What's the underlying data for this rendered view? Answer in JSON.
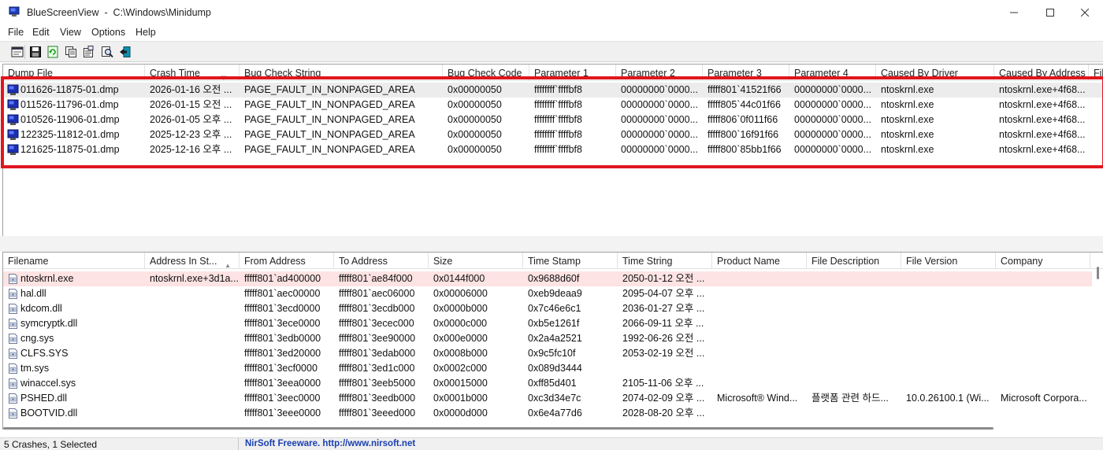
{
  "window": {
    "title": "BlueScreenView  -  C:\\Windows\\Minidump",
    "icon": "bluescreen-monitor-icon"
  },
  "menu": [
    "File",
    "Edit",
    "View",
    "Options",
    "Help"
  ],
  "toolbar": {
    "icons": [
      "html-report-icon",
      "save-icon",
      "refresh-icon",
      "copy-icon",
      "properties-icon",
      "find-icon",
      "exit-icon"
    ]
  },
  "crash_list": {
    "columns": [
      "Dump File",
      "Crash Time",
      "Bug Check String",
      "Bug Check Code",
      "Parameter 1",
      "Parameter 2",
      "Parameter 3",
      "Parameter 4",
      "Caused By Driver",
      "Caused By Address",
      "Fil"
    ],
    "rows": [
      [
        "011626-11875-01.dmp",
        "2026-01-16 오전 ...",
        "PAGE_FAULT_IN_NONPAGED_AREA",
        "0x00000050",
        "ffffffff`ffffbf8",
        "00000000`0000...",
        "fffff801`41521f66",
        "00000000`0000...",
        "ntoskrnl.exe",
        "ntoskrnl.exe+4f68..."
      ],
      [
        "011526-11796-01.dmp",
        "2026-01-15 오전 ...",
        "PAGE_FAULT_IN_NONPAGED_AREA",
        "0x00000050",
        "ffffffff`ffffbf8",
        "00000000`0000...",
        "fffff805`44c01f66",
        "00000000`0000...",
        "ntoskrnl.exe",
        "ntoskrnl.exe+4f68..."
      ],
      [
        "010526-11906-01.dmp",
        "2026-01-05 오후 ...",
        "PAGE_FAULT_IN_NONPAGED_AREA",
        "0x00000050",
        "ffffffff`ffffbf8",
        "00000000`0000...",
        "fffff806`0f011f66",
        "00000000`0000...",
        "ntoskrnl.exe",
        "ntoskrnl.exe+4f68..."
      ],
      [
        "122325-11812-01.dmp",
        "2025-12-23 오후 ...",
        "PAGE_FAULT_IN_NONPAGED_AREA",
        "0x00000050",
        "ffffffff`ffffbf8",
        "00000000`0000...",
        "fffff800`16f91f66",
        "00000000`0000...",
        "ntoskrnl.exe",
        "ntoskrnl.exe+4f68..."
      ],
      [
        "121625-11875-01.dmp",
        "2025-12-16 오후 ...",
        "PAGE_FAULT_IN_NONPAGED_AREA",
        "0x00000050",
        "ffffffff`ffffbf8",
        "00000000`0000...",
        "fffff800`85bb1f66",
        "00000000`0000...",
        "ntoskrnl.exe",
        "ntoskrnl.exe+4f68..."
      ]
    ]
  },
  "driver_list": {
    "columns": [
      "Filename",
      "Address In St...",
      "From Address",
      "To Address",
      "Size",
      "Time Stamp",
      "Time String",
      "Product Name",
      "File Description",
      "File Version",
      "Company"
    ],
    "rows": [
      [
        "ntoskrnl.exe",
        "ntoskrnl.exe+3d1a...",
        "fffff801`ad400000",
        "fffff801`ae84f000",
        "0x0144f000",
        "0x9688d60f",
        "2050-01-12 오전 ...",
        "",
        "",
        "",
        ""
      ],
      [
        "hal.dll",
        "",
        "fffff801`aec00000",
        "fffff801`aec06000",
        "0x00006000",
        "0xeb9deaa9",
        "2095-04-07 오후 ...",
        "",
        "",
        "",
        ""
      ],
      [
        "kdcom.dll",
        "",
        "fffff801`3ecd0000",
        "fffff801`3ecdb000",
        "0x0000b000",
        "0x7c46e6c1",
        "2036-01-27 오후 ...",
        "",
        "",
        "",
        ""
      ],
      [
        "symcryptk.dll",
        "",
        "fffff801`3ece0000",
        "fffff801`3ecec000",
        "0x0000c000",
        "0xb5e1261f",
        "2066-09-11 오후 ...",
        "",
        "",
        "",
        ""
      ],
      [
        "cng.sys",
        "",
        "fffff801`3edb0000",
        "fffff801`3ee90000",
        "0x000e0000",
        "0x2a4a2521",
        "1992-06-26 오전 ...",
        "",
        "",
        "",
        ""
      ],
      [
        "CLFS.SYS",
        "",
        "fffff801`3ed20000",
        "fffff801`3edab000",
        "0x0008b000",
        "0x9c5fc10f",
        "2053-02-19 오전 ...",
        "",
        "",
        "",
        ""
      ],
      [
        "tm.sys",
        "",
        "fffff801`3ecf0000",
        "fffff801`3ed1c000",
        "0x0002c000",
        "0x089d3444",
        "",
        "",
        "",
        "",
        ""
      ],
      [
        "winaccel.sys",
        "",
        "fffff801`3eea0000",
        "fffff801`3eeb5000",
        "0x00015000",
        "0xff85d401",
        "2105-11-06 오후 ...",
        "",
        "",
        "",
        ""
      ],
      [
        "PSHED.dll",
        "",
        "fffff801`3eec0000",
        "fffff801`3eedb000",
        "0x0001b000",
        "0xc3d34e7c",
        "2074-02-09 오후 ...",
        "Microsoft® Wind...",
        "플랫폼 관련 하드...",
        "10.0.26100.1 (Wi...",
        "Microsoft Corpora..."
      ],
      [
        "BOOTVID.dll",
        "",
        "fffff801`3eee0000",
        "fffff801`3eeed000",
        "0x0000d000",
        "0x6e4a77d6",
        "2028-08-20 오후 ...",
        "",
        "",
        "",
        ""
      ]
    ]
  },
  "status": {
    "summary": "5 Crashes, 1 Selected",
    "link": "NirSoft Freeware.  http://www.nirsoft.net"
  },
  "colors": {
    "highlight_box": "#e0161e",
    "selected_row": "#ececec",
    "driver_highlight": "#fde3e3",
    "link": "#1a3fb0"
  }
}
